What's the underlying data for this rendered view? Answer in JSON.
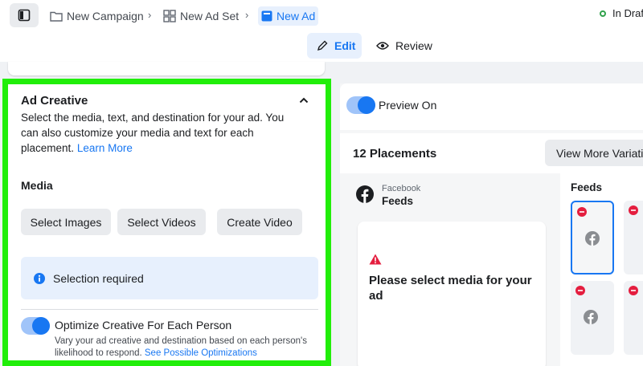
{
  "breadcrumbs": {
    "campaign": "New Campaign",
    "adset": "New Ad Set",
    "ad": "New Ad"
  },
  "status": "In Draft",
  "modes": {
    "edit": "Edit",
    "review": "Review"
  },
  "ad_creative": {
    "title": "Ad Creative",
    "description": "Select the media, text, and destination for your ad. You can also customize your media and text for each placement.",
    "learn_more": "Learn More",
    "media_label": "Media",
    "buttons": {
      "select_images": "Select Images",
      "select_videos": "Select Videos",
      "create_video": "Create Video"
    },
    "selection_required": "Selection required",
    "optimize": {
      "label": "Optimize Creative For Each Person",
      "enabled": true,
      "description": "Vary your ad creative and destination based on each person's likelihood to respond.",
      "link": "See Possible Optimizations"
    }
  },
  "preview": {
    "label": "Preview On",
    "enabled": true,
    "placements_title": "12 Placements",
    "view_more": "View More Variations",
    "platform": "Facebook",
    "placement": "Feeds",
    "media_message": "Please select media for your ad",
    "feeds_label": "Feeds"
  },
  "colors": {
    "accent": "#1877f2",
    "highlight_border": "#21ee0a",
    "status_dot": "#31a24c",
    "warning": "#e41e3f"
  }
}
